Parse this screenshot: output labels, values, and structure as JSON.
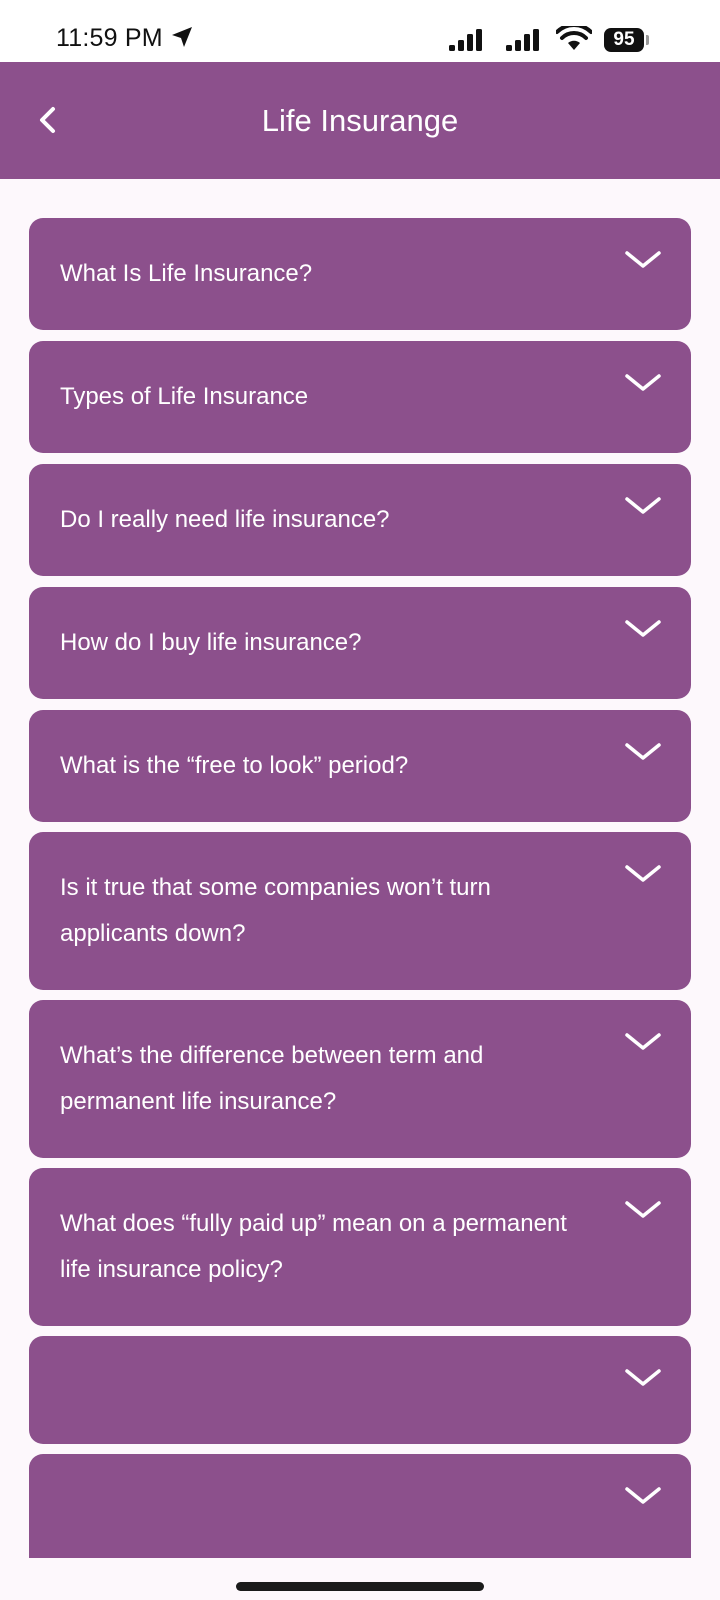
{
  "status_bar": {
    "time": "11:59 PM",
    "battery": "95",
    "icons": [
      "location-arrow-icon",
      "signal-icon",
      "signal-icon",
      "wifi-icon",
      "battery-icon"
    ]
  },
  "app_bar": {
    "title": "Life Insurange",
    "back_icon": "chevron-left-icon",
    "color": "#8c508c"
  },
  "faq": {
    "expand_icon": "chevron-down-icon",
    "items": [
      {
        "question": "What Is Life Insurance?"
      },
      {
        "question": "Types of Life Insurance"
      },
      {
        "question": "Do I really need life insurance?"
      },
      {
        "question": "How do I buy life insurance?"
      },
      {
        "question": "What is the “free to look” period?"
      },
      {
        "question": "Is it true that some companies won’t turn applicants down?"
      },
      {
        "question": "What’s the difference between term and permanent life insurance?"
      },
      {
        "question": "What does “fully paid up” mean on a permanent life insurance policy?"
      },
      {
        "question": ""
      },
      {
        "question": ""
      }
    ]
  }
}
